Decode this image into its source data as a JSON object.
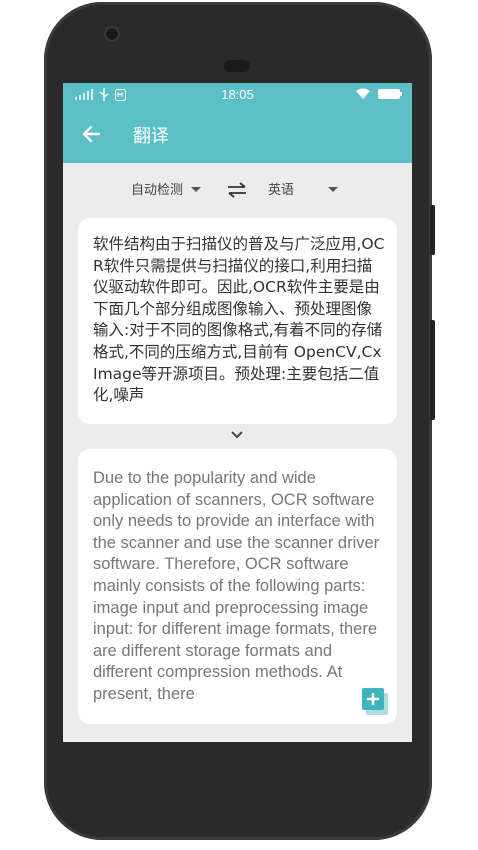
{
  "status_bar": {
    "time": "18:05"
  },
  "app_bar": {
    "title": "翻译"
  },
  "language_bar": {
    "source_lang": "自动检测",
    "target_lang": "英语"
  },
  "source": {
    "text": "软件结构由于扫描仪的普及与广泛应用,OCR软件只需提供与扫描仪的接口,利用扫描仪驱动软件即可。因此,OCR软件主要是由下面几个部分组成图像输入、预处理图像输入:对于不同的图像格式,有着不同的存储格式,不同的压缩方式,目前有 OpenCV,CxImage等开源项目。预处理:主要包括二值化,噪声"
  },
  "translation": {
    "text": "Due to the popularity and wide application of scanners, OCR software only needs to provide an interface with the scanner and use the scanner driver software. Therefore, OCR software mainly consists of the following parts: image input and preprocessing image input: for different image formats, there are different storage formats and different compression methods. At present, there"
  },
  "colors": {
    "accent": "#5bbfc6",
    "copy_icon": "#3fb4bc"
  },
  "icons": [
    "back-arrow-icon",
    "swap-icon",
    "chevron-down-icon",
    "copy-add-icon",
    "wifi-icon",
    "battery-icon",
    "signal-icon",
    "usb-icon"
  ]
}
